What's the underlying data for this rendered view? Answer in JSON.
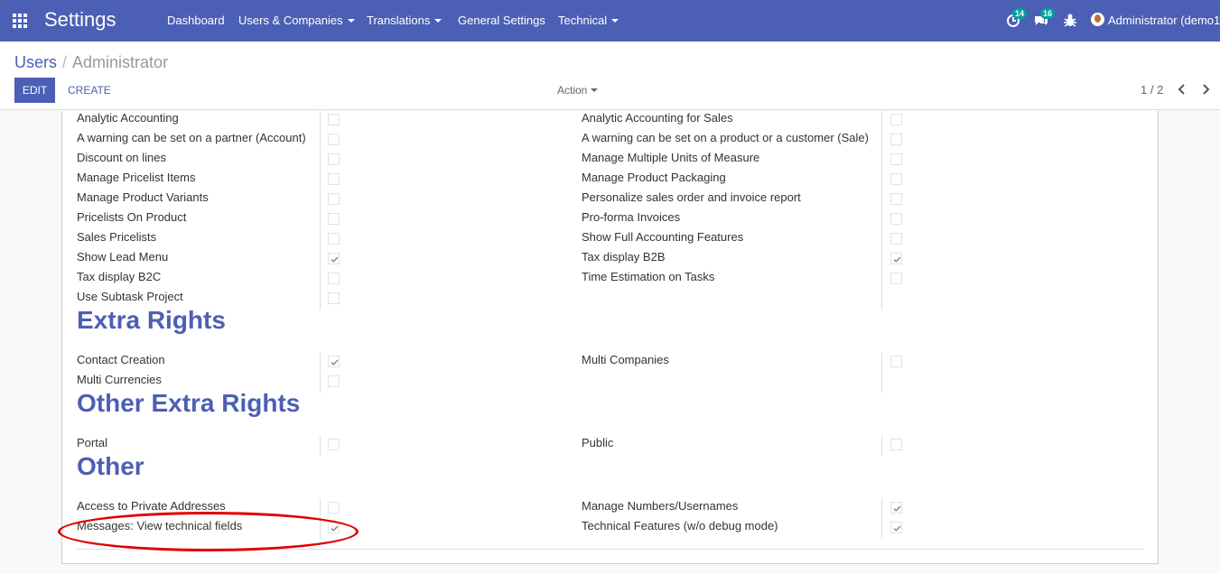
{
  "topbar": {
    "app_title": "Settings",
    "menu": [
      {
        "label": "Dashboard",
        "dropdown": false
      },
      {
        "label": "Users & Companies",
        "dropdown": true
      },
      {
        "label": "Translations",
        "dropdown": true
      },
      {
        "label": "General Settings",
        "dropdown": false
      },
      {
        "label": "Technical",
        "dropdown": true
      }
    ],
    "activity_count": "14",
    "messages_count": "16",
    "user_label": "Administrator (demo1"
  },
  "control_panel": {
    "breadcrumb_parent": "Users",
    "breadcrumb_current": "Administrator",
    "edit_label": "EDIT",
    "create_label": "CREATE",
    "action_label": "Action",
    "pager": "1 / 2"
  },
  "form": {
    "rows_top": [
      {
        "left": "Analytic Accounting",
        "left_checked": false,
        "right": "Analytic Accounting for Sales",
        "right_checked": false
      },
      {
        "left": "A warning can be set on a partner (Account)",
        "left_checked": false,
        "right": "A warning can be set on a product or a customer (Sale)",
        "right_checked": false
      },
      {
        "left": "Discount on lines",
        "left_checked": false,
        "right": "Manage Multiple Units of Measure",
        "right_checked": false
      },
      {
        "left": "Manage Pricelist Items",
        "left_checked": false,
        "right": "Manage Product Packaging",
        "right_checked": false
      },
      {
        "left": "Manage Product Variants",
        "left_checked": false,
        "right": "Personalize sales order and invoice report",
        "right_checked": false
      },
      {
        "left": "Pricelists On Product",
        "left_checked": false,
        "right": "Pro-forma Invoices",
        "right_checked": false
      },
      {
        "left": "Sales Pricelists",
        "left_checked": false,
        "right": "Show Full Accounting Features",
        "right_checked": false
      },
      {
        "left": "Show Lead Menu",
        "left_checked": true,
        "right": "Tax display B2B",
        "right_checked": true
      },
      {
        "left": "Tax display B2C",
        "left_checked": false,
        "right": "Time Estimation on Tasks",
        "right_checked": false
      },
      {
        "left": "Use Subtask Project",
        "left_checked": false
      }
    ],
    "extra_rights": {
      "title": "Extra Rights",
      "rows": [
        {
          "left": "Contact Creation",
          "left_checked": true,
          "right": "Multi Companies",
          "right_checked": false
        },
        {
          "left": "Multi Currencies",
          "left_checked": false
        }
      ]
    },
    "other_extra_rights": {
      "title": "Other Extra Rights",
      "rows": [
        {
          "left": "Portal",
          "left_checked": false,
          "right": "Public",
          "right_checked": false
        }
      ]
    },
    "other": {
      "title": "Other",
      "rows": [
        {
          "left": "Access to Private Addresses",
          "left_checked": false,
          "right": "Manage Numbers/Usernames",
          "right_checked": true
        },
        {
          "left": "Messages: View technical fields",
          "left_checked": true,
          "right": "Technical Features (w/o debug mode)",
          "right_checked": true
        }
      ]
    }
  }
}
